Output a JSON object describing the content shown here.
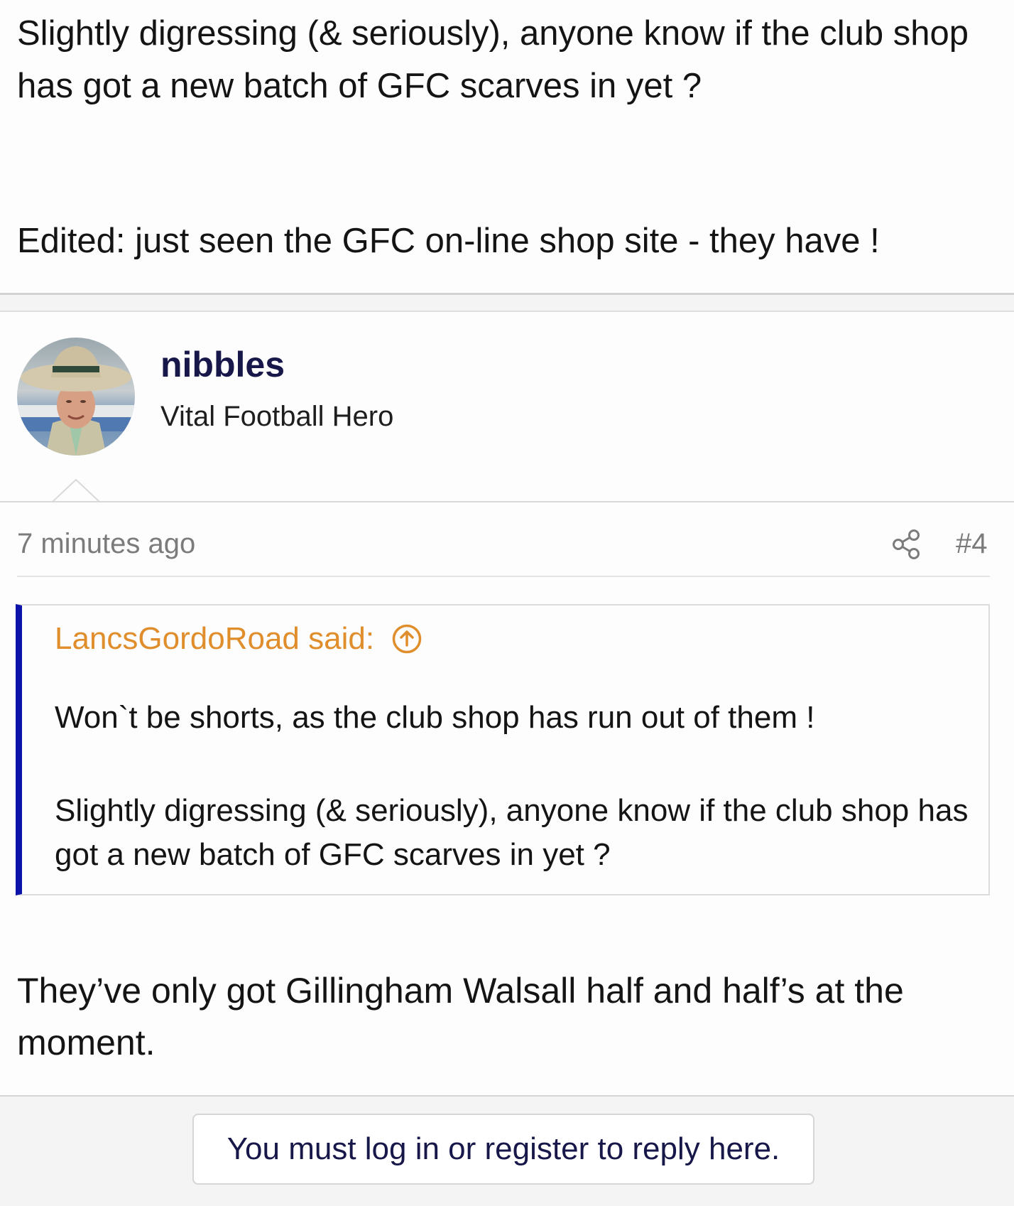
{
  "previous_post": {
    "body_line_1": "Slightly digressing (& seriously), anyone know if the club shop has got a new batch of GFC scarves in yet ?",
    "body_line_2": "Edited: just seen the GFC on-line shop site - they have !"
  },
  "post": {
    "username": "nibbles",
    "user_title": "Vital Football Hero",
    "avatar_icon": "user-avatar",
    "timestamp": "7 minutes ago",
    "share_icon": "share-icon",
    "post_number": "#4",
    "quote": {
      "attribution": "LancsGordoRoad said:",
      "jump_icon": "arrow-up-circle-icon",
      "line_1": "Won`t be shorts, as the club shop has run out of them !",
      "line_2": "Slightly digressing (& seriously), anyone know if the club shop has got a new batch of GFC scarves in yet ?"
    },
    "body": "They’ve only got Gillingham Walsall half and half’s at the moment."
  },
  "footer": {
    "login_prompt": "You must log in or register to reply here."
  },
  "colors": {
    "username": "#17174a",
    "quote_accent_bar": "#0b13a8",
    "quote_attribution": "#e08d2b",
    "meta_text": "#7b7b7b"
  }
}
